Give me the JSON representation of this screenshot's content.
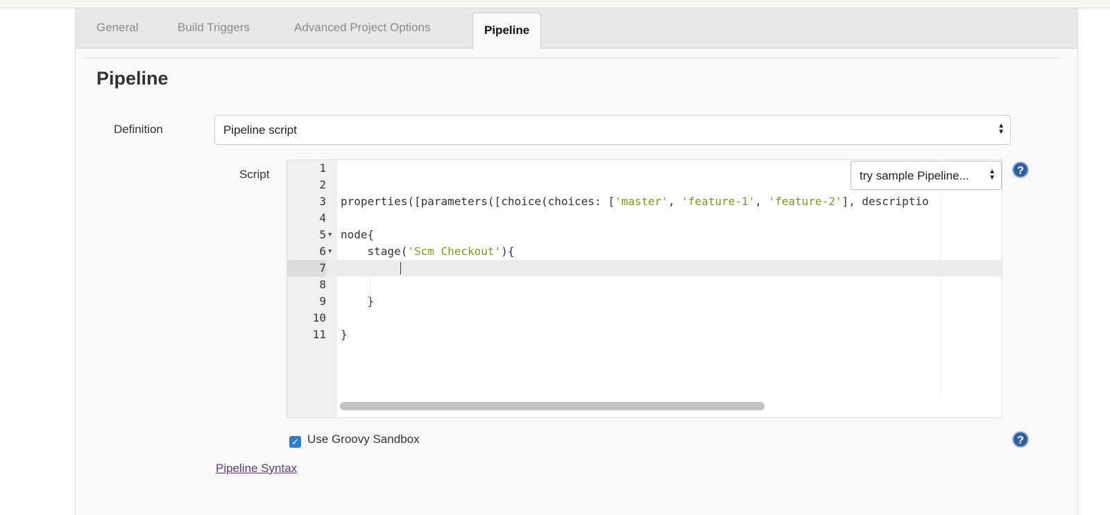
{
  "tabs": [
    {
      "label": "General"
    },
    {
      "label": "Build Triggers"
    },
    {
      "label": "Advanced Project Options"
    },
    {
      "label": "Pipeline",
      "active": true
    }
  ],
  "section_title": "Pipeline",
  "definition": {
    "label": "Definition",
    "value": "Pipeline script"
  },
  "script": {
    "label": "Script",
    "sample_select": "try sample Pipeline...",
    "current_line": 7,
    "lines": [
      {
        "n": "1",
        "code": []
      },
      {
        "n": "2",
        "code": []
      },
      {
        "n": "3",
        "code": [
          {
            "t": "properties([parameters([choice(choices: ["
          },
          {
            "t": "'master'",
            "s": 1
          },
          {
            "t": ", "
          },
          {
            "t": "'feature-1'",
            "s": 1
          },
          {
            "t": ", "
          },
          {
            "t": "'feature-2'",
            "s": 1
          },
          {
            "t": "], descriptio"
          }
        ]
      },
      {
        "n": "4",
        "code": []
      },
      {
        "n": "5",
        "fold": true,
        "code": [
          {
            "t": "node{"
          }
        ]
      },
      {
        "n": "6",
        "fold": true,
        "code": [
          {
            "t": "    stage("
          },
          {
            "t": "'Scm Checkout'",
            "s": 1
          },
          {
            "t": "){"
          }
        ]
      },
      {
        "n": "7",
        "code": []
      },
      {
        "n": "8",
        "code": []
      },
      {
        "n": "9",
        "code": [
          {
            "t": "    }"
          }
        ]
      },
      {
        "n": "10",
        "code": []
      },
      {
        "n": "11",
        "code": [
          {
            "t": "}"
          }
        ]
      }
    ]
  },
  "sandbox": {
    "label": "Use Groovy Sandbox",
    "checked": true
  },
  "pipeline_syntax_link": "Pipeline Syntax",
  "colors": {
    "string": "#7a9a1a",
    "checkbox": "#2d7cd6",
    "help": "#2f5f9f"
  }
}
